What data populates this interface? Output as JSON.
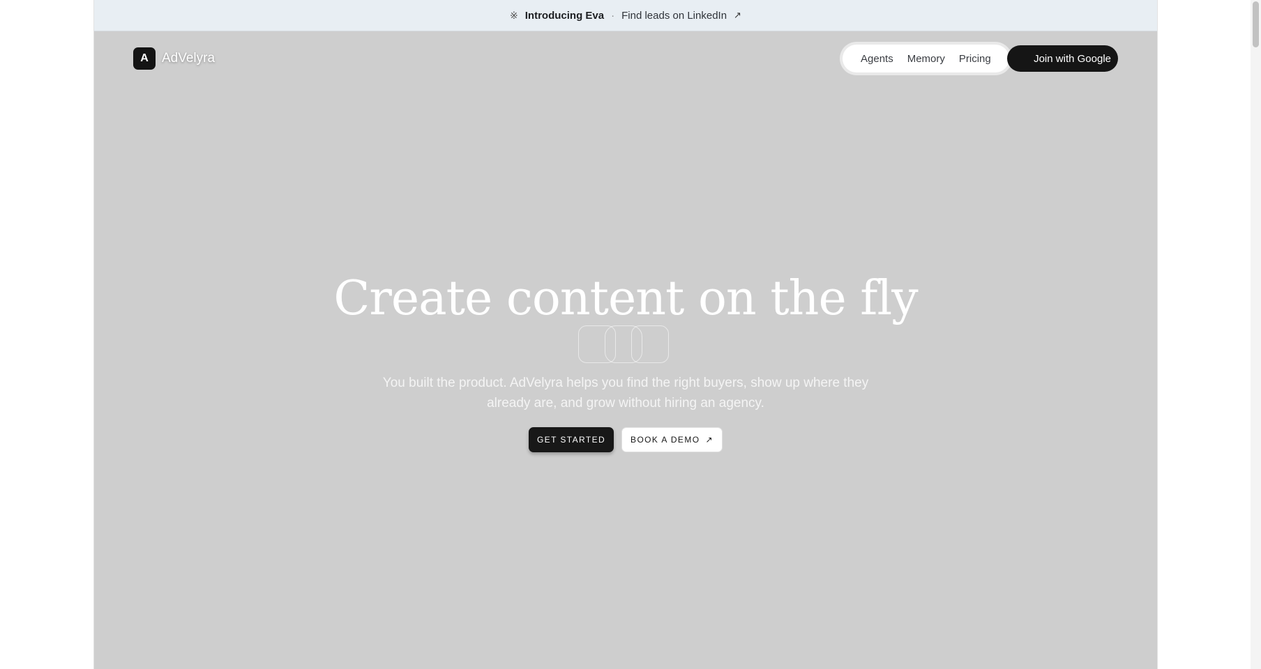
{
  "announcement": {
    "icon": "sparkle-icon",
    "title": "Introducing Eva",
    "separator": "·",
    "link_text": "Find leads on LinkedIn",
    "link_icon": "arrow-up-right-icon"
  },
  "header": {
    "logo_letter": "A",
    "brand": "AdVelyra",
    "nav": [
      "Agents",
      "Memory",
      "Pricing"
    ],
    "cta": "Join with Google"
  },
  "hero": {
    "title": "Create content on the fly",
    "subtitle": "You built the product. AdVelyra helps you find the right buyers, show up where they already are, and grow without hiring an agency.",
    "primary_cta": "GET STARTED",
    "secondary_cta": "BOOK A DEMO",
    "secondary_icon": "arrow-up-right-icon"
  },
  "colors": {
    "background": "#cecece",
    "announcement_bg": "#e8eef3",
    "dark": "#151515"
  }
}
